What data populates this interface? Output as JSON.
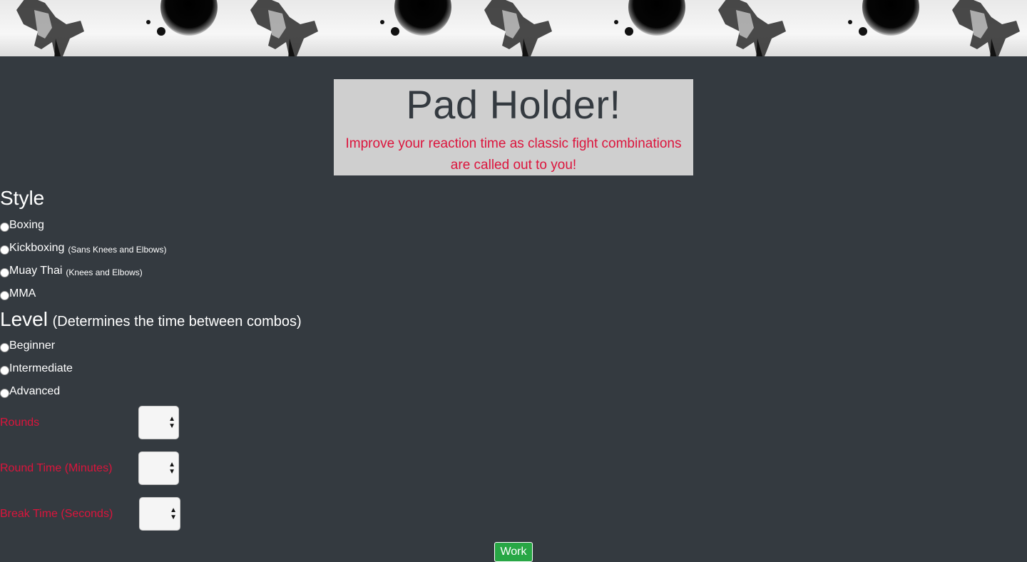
{
  "hero": {
    "title": "Pad Holder!",
    "subtitle_line1": "Improve your reaction time as classic fight combinations",
    "subtitle_line2": "are called out to you!"
  },
  "style": {
    "heading": "Style",
    "options": [
      {
        "label": "Boxing",
        "note": ""
      },
      {
        "label": "Kickboxing",
        "note": "(Sans Knees and Elbows)"
      },
      {
        "label": "Muay Thai",
        "note": "(Knees and Elbows)"
      },
      {
        "label": "MMA",
        "note": ""
      }
    ]
  },
  "level": {
    "heading": "Level",
    "note": "(Determines the time between combos)",
    "options": [
      {
        "label": "Beginner"
      },
      {
        "label": "Intermediate"
      },
      {
        "label": "Advanced"
      }
    ]
  },
  "fields": [
    {
      "label": "Rounds",
      "value": ""
    },
    {
      "label": "Round Time (Minutes)",
      "value": ""
    },
    {
      "label": "Break Time (Seconds)",
      "value": ""
    }
  ],
  "work_button": {
    "label": "Work"
  },
  "colors": {
    "background": "#343a40",
    "accent_red": "#dc143c",
    "hero_bg": "#cfcfcf",
    "work_green": "#28a745"
  }
}
